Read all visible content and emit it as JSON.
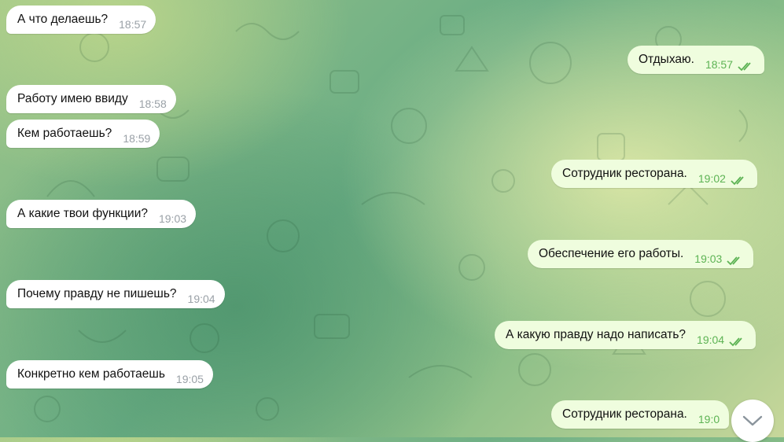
{
  "messages": [
    {
      "side": "in",
      "text": "А что делаешь?",
      "time": "18:57"
    },
    {
      "side": "out",
      "text": "Отдыхаю.",
      "time": "18:57"
    },
    {
      "side": "in",
      "text": "Работу имею ввиду",
      "time": "18:58"
    },
    {
      "side": "in",
      "text": "Кем работаешь?",
      "time": "18:59"
    },
    {
      "side": "out",
      "text": "Сотрудник ресторана.",
      "time": "19:02"
    },
    {
      "side": "in",
      "text": "А какие твои функции?",
      "time": "19:03"
    },
    {
      "side": "out",
      "text": "Обеспечение его работы.",
      "time": "19:03"
    },
    {
      "side": "in",
      "text": "Почему правду не пишешь?",
      "time": "19:04"
    },
    {
      "side": "out",
      "text": "А какую правду надо написать?",
      "time": "19:04"
    },
    {
      "side": "in",
      "text": "Конкретно кем работаешь",
      "time": "19:05"
    },
    {
      "side": "out",
      "text": "Сотрудник ресторана.",
      "time": "19:0"
    }
  ],
  "colors": {
    "incoming": "#ffffff",
    "outgoing": "#effdde",
    "read_ticks": "#5db354"
  },
  "icons": {
    "read": "double-check-icon",
    "scroll": "chevron-down-icon"
  }
}
